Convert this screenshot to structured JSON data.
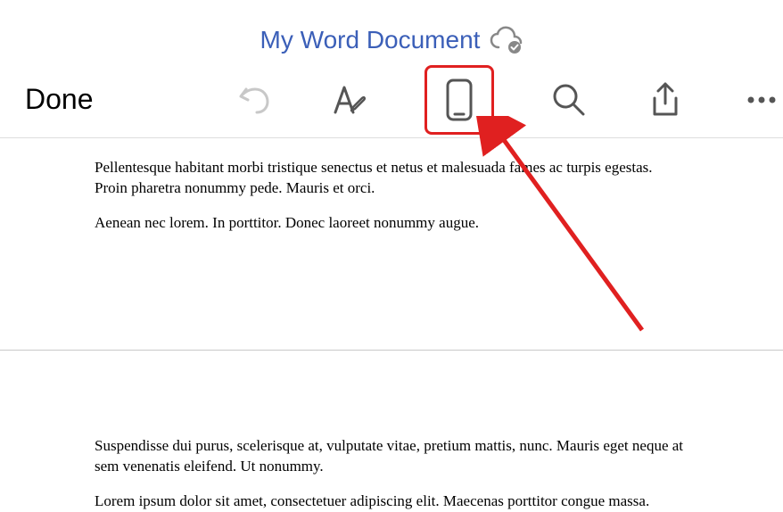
{
  "header": {
    "title": "My Word Document",
    "done_label": "Done"
  },
  "document": {
    "p1": "Pellentesque habitant morbi tristique senectus et netus et malesuada fames ac turpis egestas. Proin pharetra nonummy pede. Mauris et orci.",
    "p2": "Aenean nec lorem. In porttitor. Donec laoreet nonummy augue.",
    "p3": "Suspendisse dui purus, scelerisque at, vulputate vitae, pretium mattis, nunc. Mauris eget neque at sem venenatis eleifend. Ut nonummy.",
    "p4": "Lorem ipsum dolor sit amet, consectetuer adipiscing elit. Maecenas porttitor congue massa."
  }
}
